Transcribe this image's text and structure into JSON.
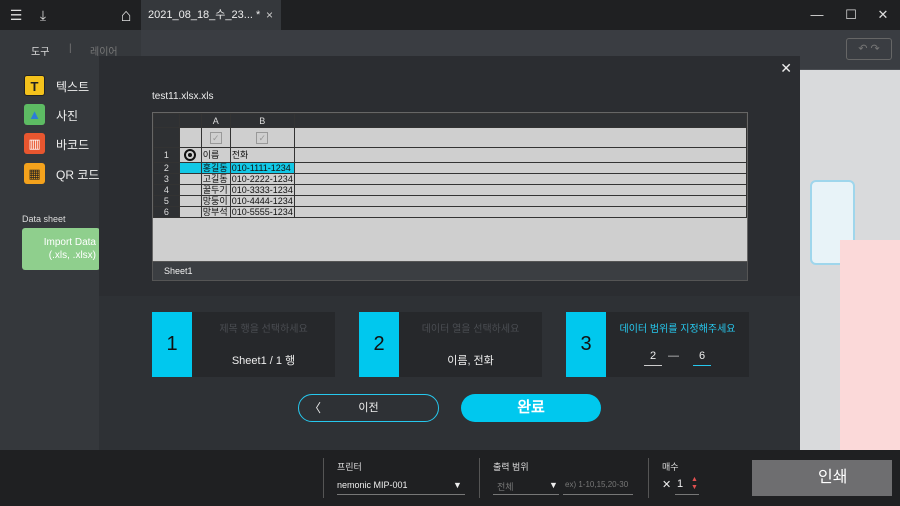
{
  "titlebar": {
    "tab_title": "2021_08_18_수_23... *",
    "tab_close": "×",
    "menu_glyph": "☰",
    "download_glyph": "⤓",
    "home_glyph": "⌂",
    "min_glyph": "—",
    "max_glyph": "☐",
    "close_glyph": "✕"
  },
  "leftpanel": {
    "tab_tools": "도구",
    "tab_layers": "레이어",
    "tab_sep": "|",
    "tools": [
      {
        "label": "텍스트",
        "glyph": "T"
      },
      {
        "label": "사진",
        "glyph": "▲"
      },
      {
        "label": "바코드",
        "glyph": "▥"
      },
      {
        "label": "QR 코드",
        "glyph": "▦"
      }
    ],
    "datasheet_label": "Data sheet",
    "import_line1": "Import Data",
    "import_line2": "(.xls, .xlsx)"
  },
  "toolbar": {
    "undo_glyph": "↶ ↷"
  },
  "modal": {
    "close_glyph": "✕",
    "filename": "test11.xlsx.xls",
    "sheet_name": "Sheet1",
    "columns": [
      "A",
      "B"
    ],
    "check_glyph": "✓",
    "rows": [
      {
        "num": "1",
        "a": "이름",
        "b": "전화"
      },
      {
        "num": "2",
        "a": "홍길동",
        "b": "010-1111-1234"
      },
      {
        "num": "3",
        "a": "고길동",
        "b": "010-2222-1234"
      },
      {
        "num": "4",
        "a": "꿀두기",
        "b": "010-3333-1234"
      },
      {
        "num": "5",
        "a": "망둥이",
        "b": "010-4444-1234"
      },
      {
        "num": "6",
        "a": "망부석",
        "b": "010-5555-1234"
      }
    ],
    "steps": [
      {
        "num": "1",
        "title": "제목 행을 선택하세요",
        "value": "Sheet1 / 1 행"
      },
      {
        "num": "2",
        "title": "데이터 열을 선택하세요",
        "value": "이름, 전화"
      },
      {
        "num": "3",
        "title": "데이터 범위를 지정해주세요",
        "range_from": "2",
        "range_dash": "—",
        "range_to": "6"
      }
    ],
    "prev_label": "이전",
    "prev_glyph": "〈",
    "done_label": "완료"
  },
  "bottombar": {
    "printer_label": "프린터",
    "printer_value": "nemonic MIP-001",
    "range_label": "출력 범위",
    "range_value": "전체",
    "range_placeholder": "ex) 1-10,15,20-30",
    "copies_label": "매수",
    "copies_prefix": "✕",
    "copies_value": "1",
    "print_label": "인쇄"
  }
}
